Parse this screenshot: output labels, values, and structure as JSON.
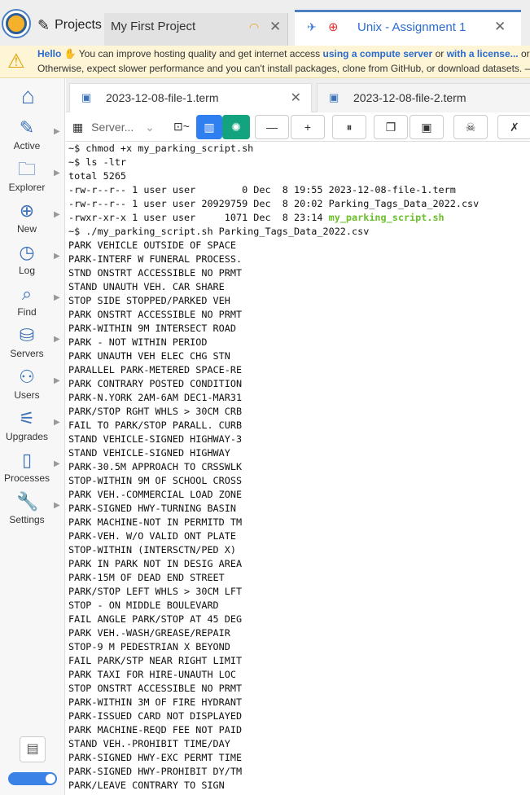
{
  "topbar": {
    "projects_label": "Projects",
    "project_tab_label": "My First Project",
    "active_tab_label": "Unix - Assignment 1"
  },
  "banner": {
    "hello": "Hello",
    "text1": "You can improve hosting quality and get internet access",
    "link1": "using a compute server",
    "or": "or",
    "link2": "with a license...",
    "tail1": "or",
    "line2": "Otherwise, expect slower performance and you can't install packages, clone from GitHub, or download datasets. –"
  },
  "sidebar": {
    "items": [
      {
        "label": "Active",
        "icon": "pencil-icon"
      },
      {
        "label": "Explorer",
        "icon": "folder-icon"
      },
      {
        "label": "New",
        "icon": "plus-circle-icon"
      },
      {
        "label": "Log",
        "icon": "history-icon"
      },
      {
        "label": "Find",
        "icon": "search-icon"
      },
      {
        "label": "Servers",
        "icon": "server-icon"
      },
      {
        "label": "Users",
        "icon": "user-plus-icon"
      },
      {
        "label": "Upgrades",
        "icon": "sliders-icon"
      },
      {
        "label": "Processes",
        "icon": "cpu-icon"
      },
      {
        "label": "Settings",
        "icon": "wrench-icon"
      }
    ]
  },
  "filetabs": [
    {
      "label": "2023-12-08-file-1.term"
    },
    {
      "label": "2023-12-08-file-2.term"
    }
  ],
  "toolbar": {
    "server_label": "Server...",
    "term_label": "~"
  },
  "terminal": {
    "lines": [
      "~$ chmod +x my_parking_script.sh",
      "~$ ls -ltr",
      "total 5265",
      "-rw-r--r-- 1 user user        0 Dec  8 19:55 2023-12-08-file-1.term",
      "-rw-r--r-- 1 user user 20929759 Dec  8 20:02 Parking_Tags_Data_2022.csv",
      "-rwxr-xr-x 1 user user     1071 Dec  8 23:14 ",
      "~$ ./my_parking_script.sh Parking_Tags_Data_2022.csv",
      "PARK VEHICLE OUTSIDE OF SPACE",
      "PARK-INTERF W FUNERAL PROCESS.",
      "STND ONSTRT ACCESSIBLE NO PRMT",
      "STAND UNAUTH VEH. CAR SHARE",
      "STOP SIDE STOPPED/PARKED VEH",
      "PARK ONSTRT ACCESSIBLE NO PRMT",
      "PARK-WITHIN 9M INTERSECT ROAD",
      "PARK - NOT WITHIN PERIOD",
      "PARK UNAUTH VEH ELEC CHG STN",
      "PARALLEL PARK-METERED SPACE-RE",
      "PARK CONTRARY POSTED CONDITION",
      "PARK-N.YORK 2AM-6AM DEC1-MAR31",
      "PARK/STOP RGHT WHLS > 30CM CRB",
      "FAIL TO PARK/STOP PARALL. CURB",
      "STAND VEHICLE-SIGNED HIGHWAY-3",
      "STAND VEHICLE-SIGNED HIGHWAY",
      "PARK-30.5M APPROACH TO CRSSWLK",
      "STOP-WITHIN 9M OF SCHOOL CROSS",
      "PARK VEH.-COMMERCIAL LOAD ZONE",
      "PARK-SIGNED HWY-TURNING BASIN",
      "PARK MACHINE-NOT IN PERMITD TM",
      "PARK-VEH. W/O VALID ONT PLATE",
      "STOP-WITHIN (INTERSCTN/PED X)",
      "PARK IN PARK NOT IN DESIG AREA",
      "PARK-15M OF DEAD END STREET",
      "PARK/STOP LEFT WHLS > 30CM LFT",
      "STOP - ON MIDDLE BOULEVARD",
      "FAIL ANGLE PARK/STOP AT 45 DEG",
      "PARK VEH.-WASH/GREASE/REPAIR",
      "STOP-9 M PEDESTRIAN X BEYOND",
      "FAIL PARK/STP NEAR RIGHT LIMIT",
      "PARK TAXI FOR HIRE-UNAUTH LOC",
      "STOP ONSTRT ACCESSIBLE NO PRMT",
      "PARK-WITHIN 3M OF FIRE HYDRANT",
      "PARK-ISSUED CARD NOT DISPLAYED",
      "PARK MACHINE-REQD FEE NOT PAID",
      "STAND VEH.-PROHIBIT TIME/DAY",
      "PARK-SIGNED HWY-EXC PERMT TIME",
      "PARK-SIGNED HWY-PROHIBIT DY/TM",
      "PARK/LEAVE CONTRARY TO SIGN"
    ],
    "highlight_file": "my_parking_script.sh"
  },
  "colors": {
    "accent": "#2a6bd1",
    "icon_blue": "#3b72b9",
    "warning": "#e0a000",
    "exec_green": "#6bbf2a"
  }
}
